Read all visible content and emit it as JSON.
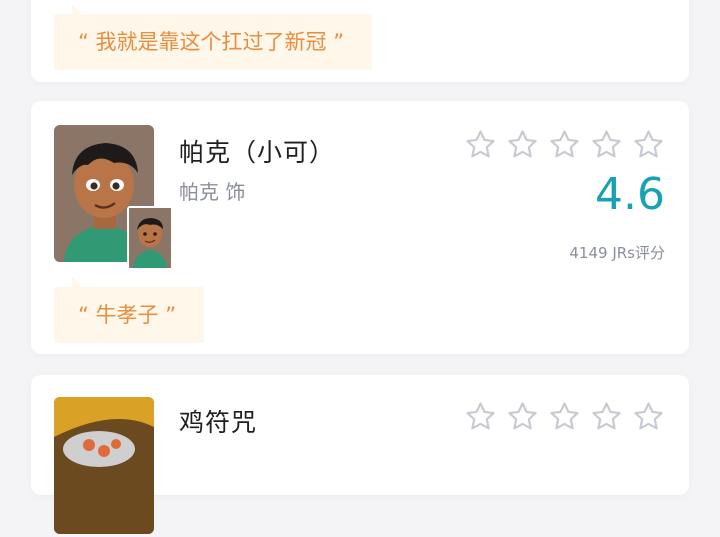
{
  "cards": [
    {
      "quote": "“ 我就是靠这个扛过了新冠 ”"
    },
    {
      "name": "帕克（小可）",
      "actor": "帕克 饰",
      "score": "4.6",
      "votes": "4149 JRs评分",
      "quote": "“ 牛孝子 ”",
      "rating_stars_filled": 0,
      "rating_stars_total": 5
    },
    {
      "name": "鸡符咒",
      "rating_stars_filled": 0,
      "rating_stars_total": 5
    }
  ],
  "colors": {
    "accent_score": "#17a2b3",
    "quote_text": "#ea8d3f",
    "quote_bg": "#fff7e9",
    "star_outline": "#c7cad3"
  }
}
